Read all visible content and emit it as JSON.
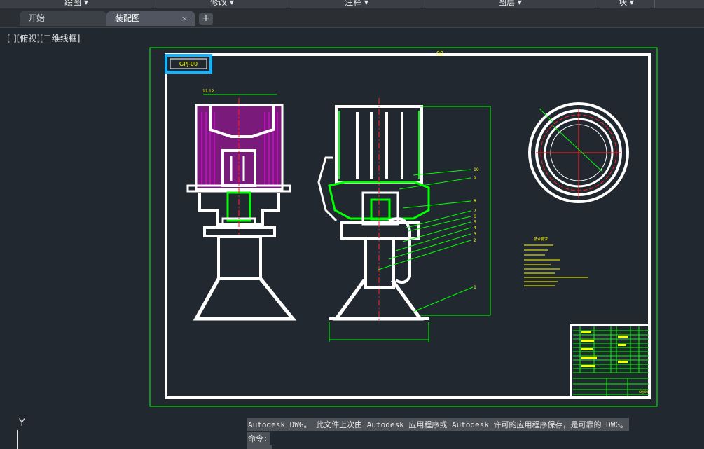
{
  "ribbon": {
    "groups": [
      "绘图",
      "修改",
      "注释",
      "图层",
      "块"
    ]
  },
  "tabs": {
    "start": "开始",
    "assembly": "装配图",
    "close_glyph": "×",
    "add_glyph": "+"
  },
  "viewport": {
    "view_label": "[-][俯视][二维线框]"
  },
  "drawing": {
    "selected_block_text": "GPJ-00",
    "frame_top_label": "00",
    "tech_req_title": "技术要求",
    "title_block_code": "GPJ-00",
    "part_numbers": [
      "10",
      "9",
      "8",
      "7",
      "6",
      "5",
      "4",
      "3",
      "2",
      "1",
      "11",
      "12"
    ]
  },
  "ucs": {
    "axis_label": "Y"
  },
  "command": {
    "message": "Autodesk DWG。 此文件上次由 Autodesk 应用程序或 Autodesk 许可的应用程序保存，是可靠的 DWG。",
    "prompt": "命令:"
  },
  "colors": {
    "background": "#212830",
    "line_white": "#ffffff",
    "line_green": "#00ff00",
    "line_magenta": "#ff00ff",
    "line_red": "#ff2020",
    "text_yellow": "#ffff00",
    "selection_cyan": "#14b4ff"
  }
}
